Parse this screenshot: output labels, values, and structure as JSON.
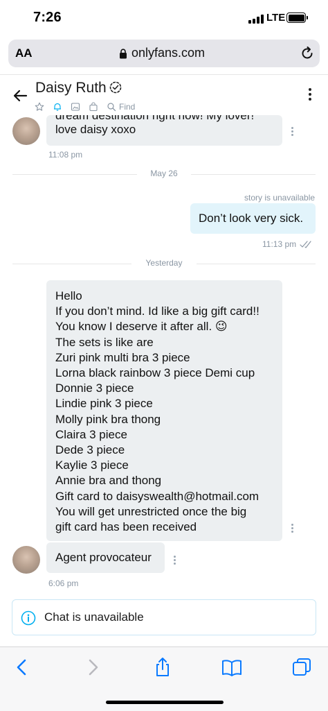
{
  "status_bar": {
    "time": "7:26",
    "network": "LTE"
  },
  "browser": {
    "text_size_button": "AA",
    "url": "onlyfans.com"
  },
  "chat_header": {
    "name": "Daisy Ruth",
    "find_label": "Find"
  },
  "messages": {
    "first": {
      "text_partial": "dream destination right now! My lover!",
      "text_line2": "love daisy xoxo",
      "time": "11:08 pm"
    },
    "date_1": "May 26",
    "own": {
      "note": "story is unavailable",
      "text": "Don’t look very sick.",
      "time": "11:13 pm"
    },
    "date_2": "Yesterday",
    "long_message_lines": [
      "Hello",
      "If you don’t mind. Id like a big gift card!!",
      "You know I deserve it after all. 😉",
      "The sets is like are",
      "Zuri pink multi bra 3 piece",
      "Lorna black rainbow 3 piece Demi cup",
      "Donnie 3 piece",
      "Lindie pink 3 piece",
      "Molly pink bra thong",
      "Claira 3 piece",
      "Dede 3 piece",
      "Kaylie 3 piece",
      "Annie bra and thong",
      "Gift card to daisyswealth@hotmail.com",
      "You will get unrestricted once the big",
      "gift card has been received"
    ],
    "short": {
      "text": "Agent provocateur",
      "time": "6:06 pm"
    }
  },
  "chat_unavailable": {
    "text": "Chat is unavailable"
  },
  "colors": {
    "accent": "#00aff0",
    "bubble_bg": "#eceff1",
    "own_bubble_bg": "#e2f4fb",
    "safari_blue": "#0a7aff"
  }
}
